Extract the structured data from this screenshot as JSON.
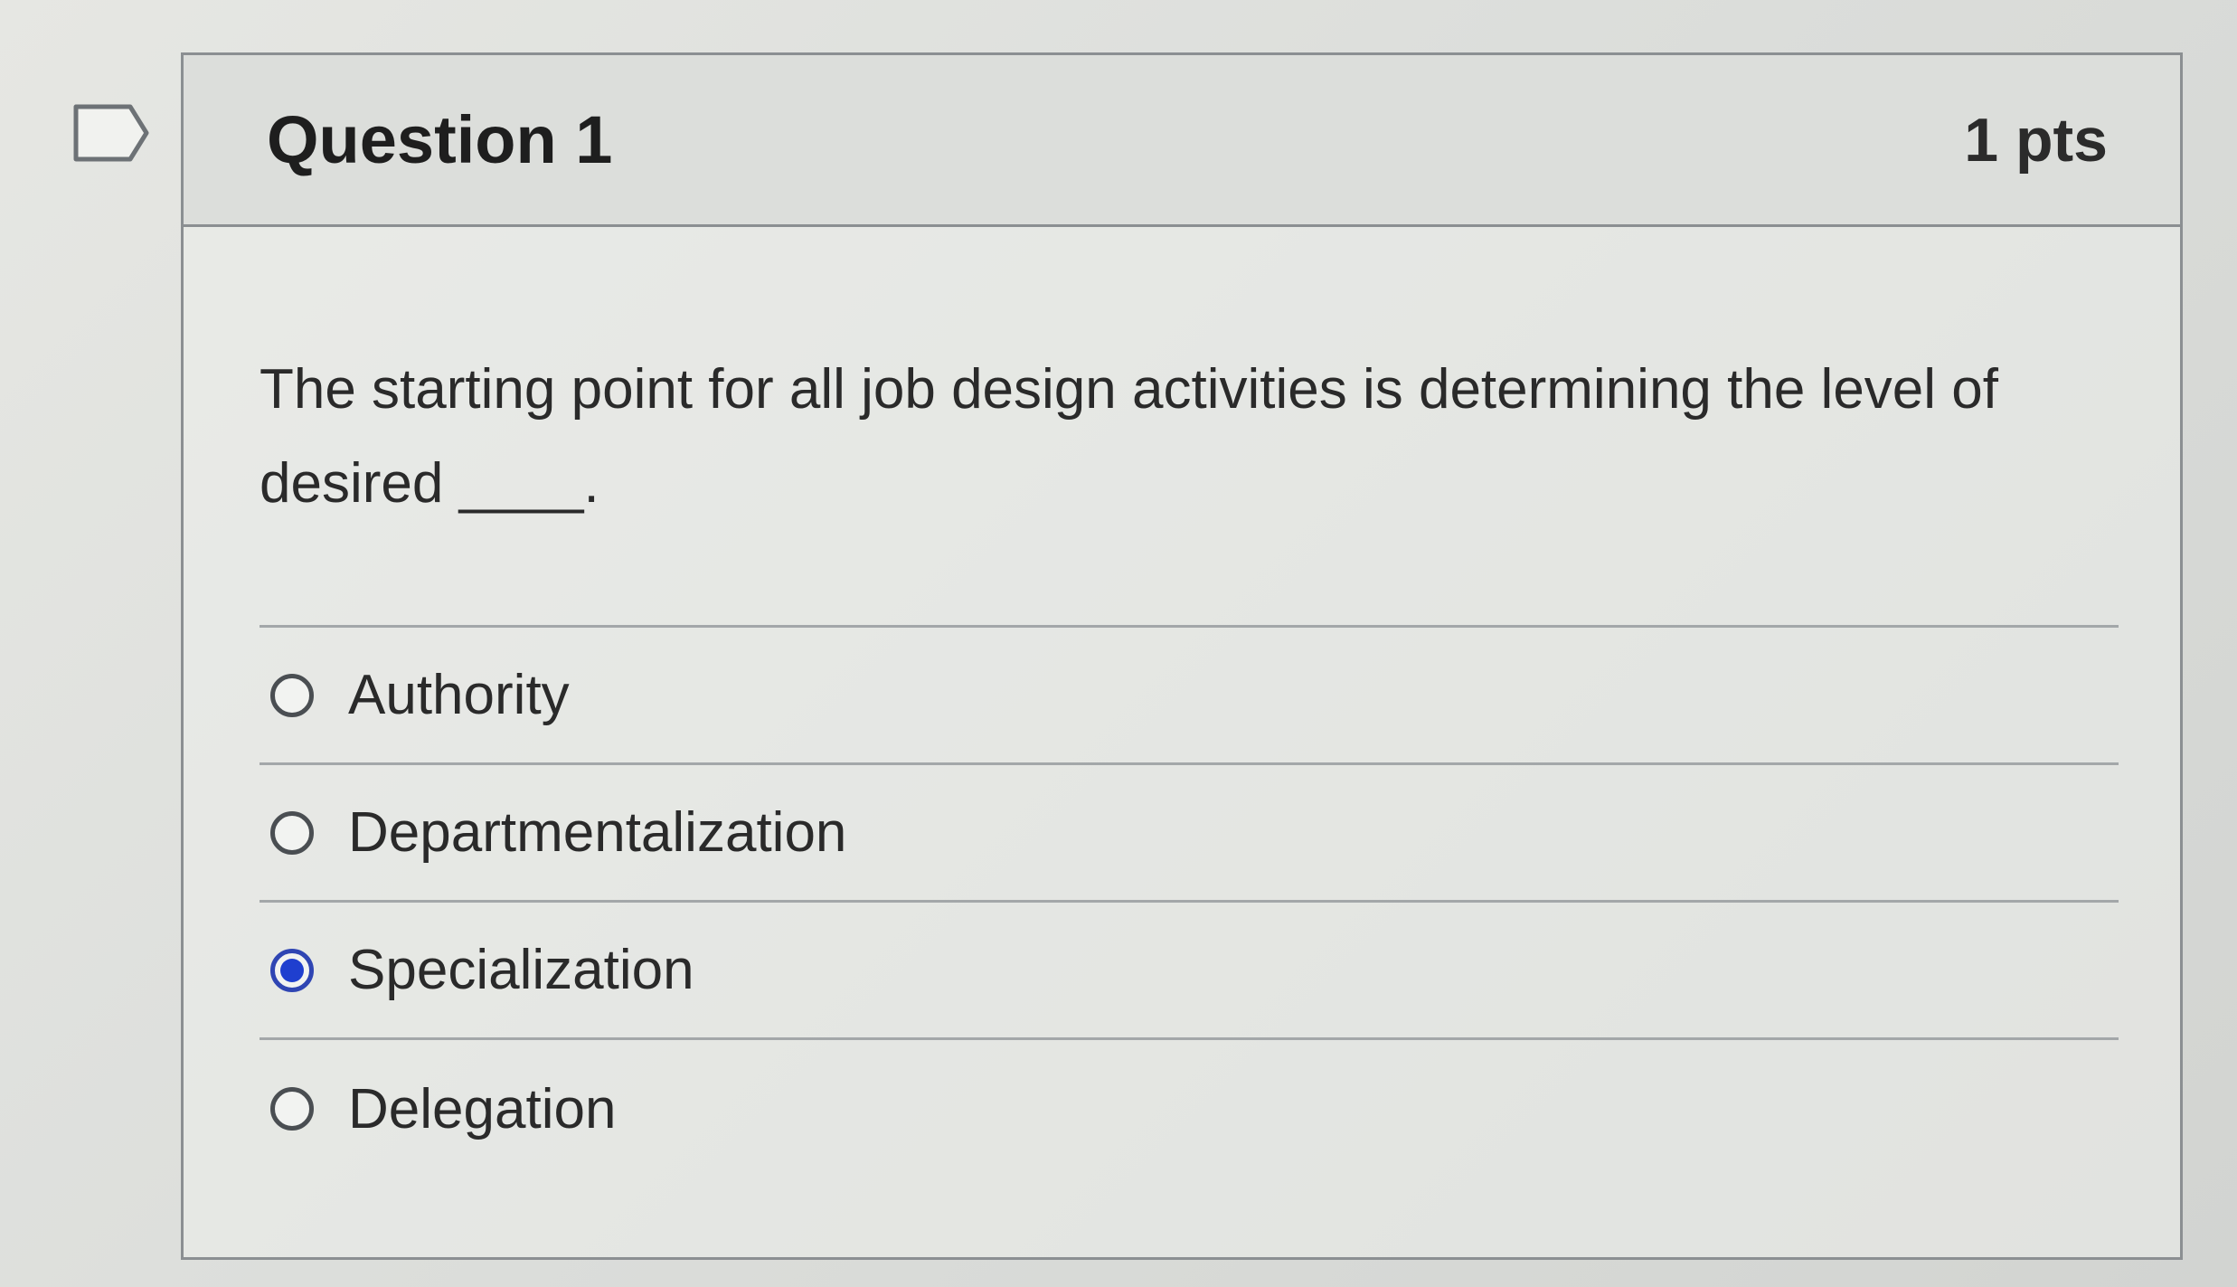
{
  "flag_icon": "flag-outline-icon",
  "question": {
    "title": "Question 1",
    "points": "1 pts",
    "text": "The starting point for all job design activities is determining the level of desired ____."
  },
  "answers": [
    {
      "label": "Authority",
      "selected": false
    },
    {
      "label": "Departmentalization",
      "selected": false
    },
    {
      "label": "Specialization",
      "selected": true
    },
    {
      "label": "Delegation",
      "selected": false
    }
  ],
  "colors": {
    "selected_radio": "#1f3fcf",
    "border": "#8b8f92"
  }
}
